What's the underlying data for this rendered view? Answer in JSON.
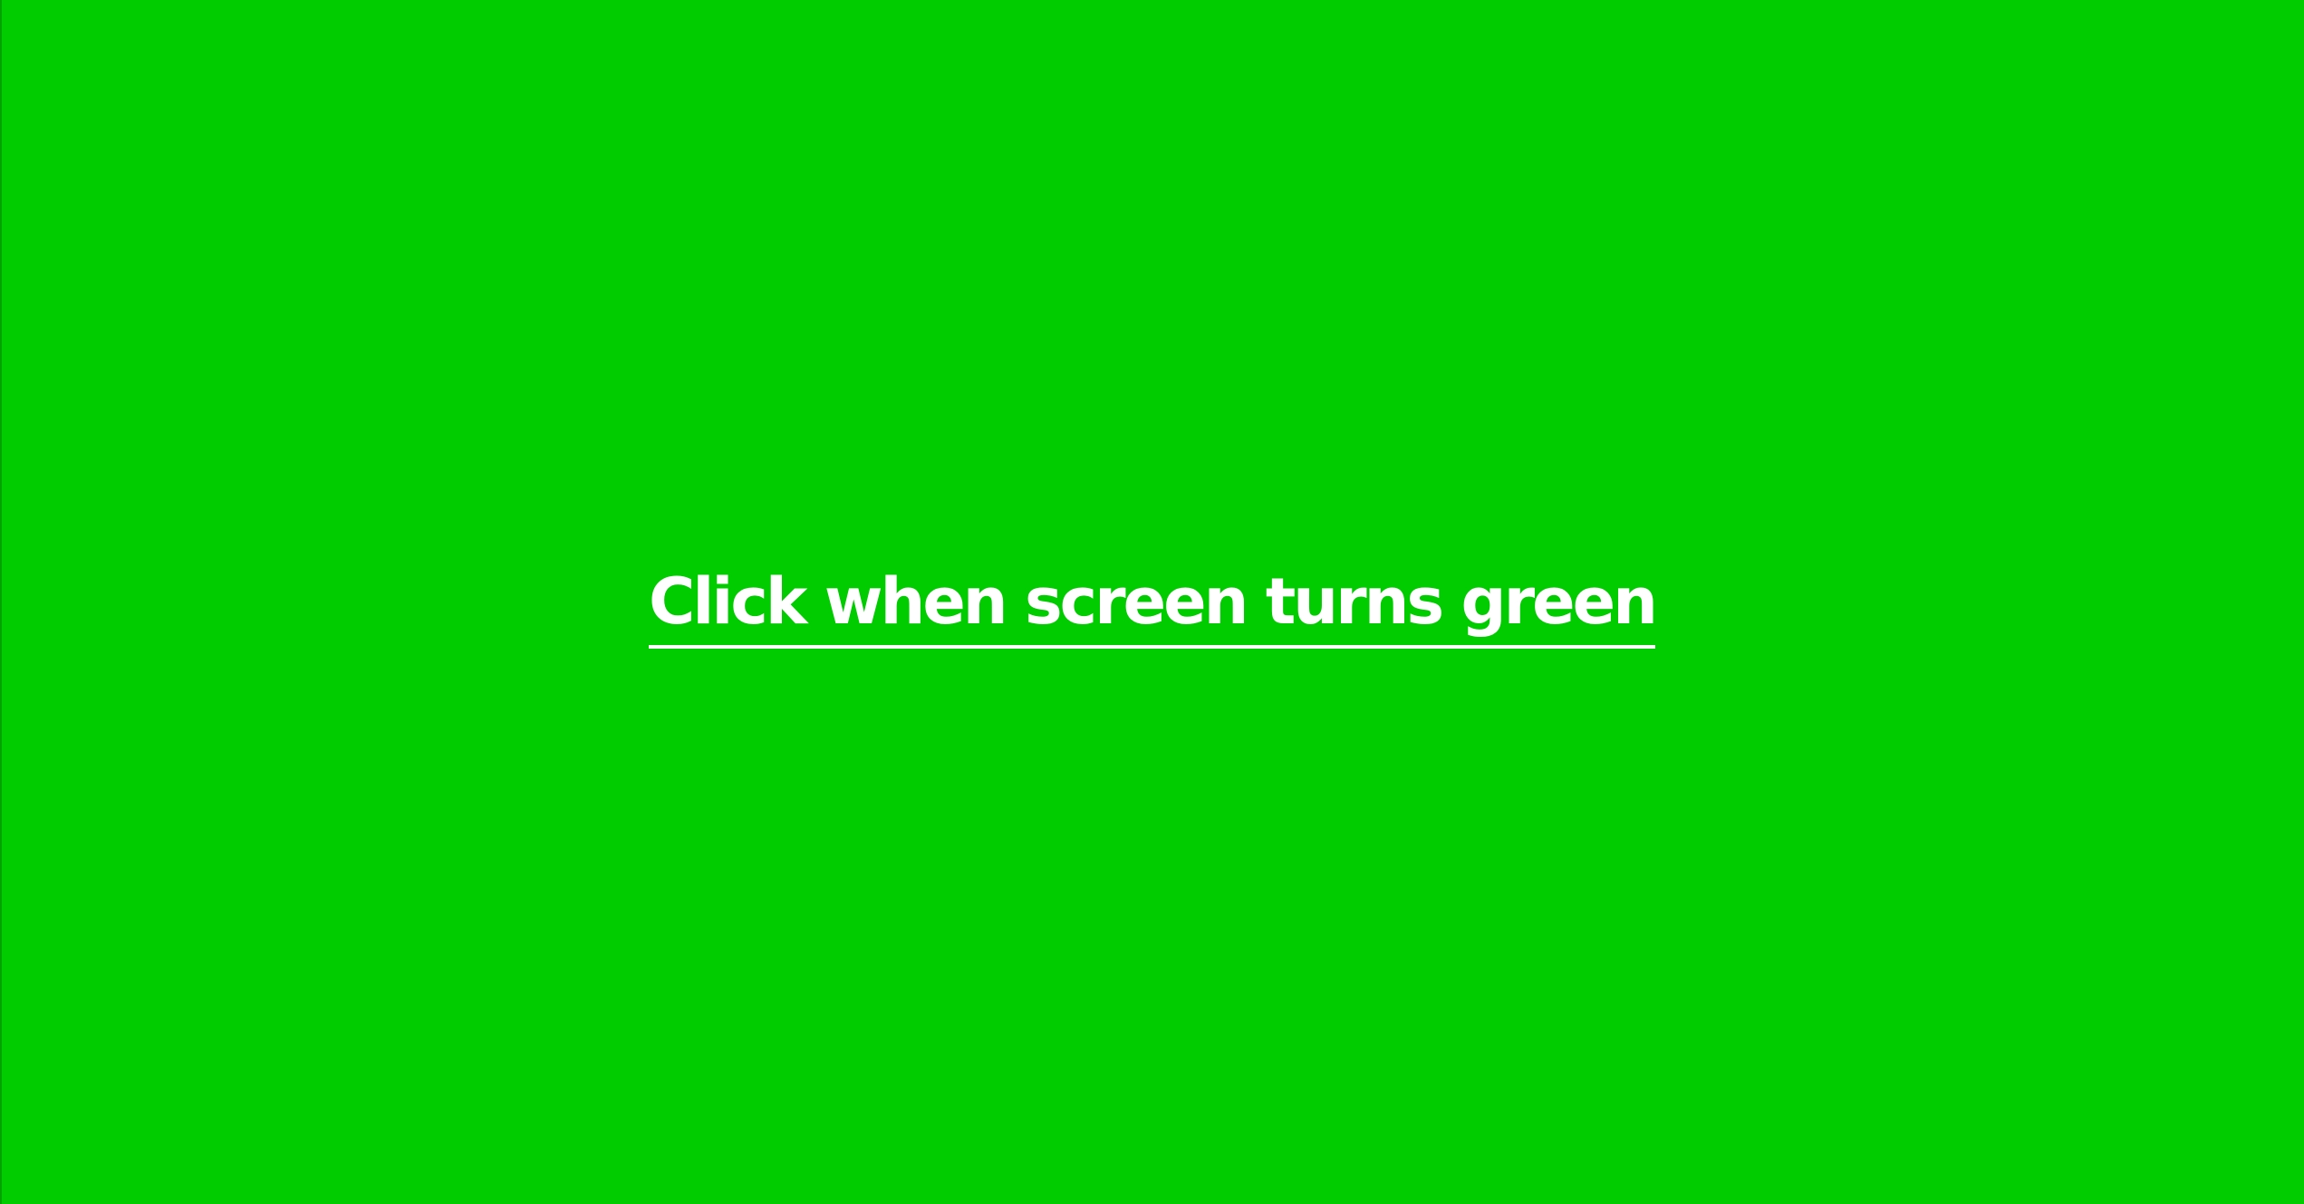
{
  "screen": {
    "state": "green",
    "background_color": "#00cc00",
    "text_color": "#ffffff"
  },
  "prompt": {
    "text": "Click when screen turns green"
  }
}
